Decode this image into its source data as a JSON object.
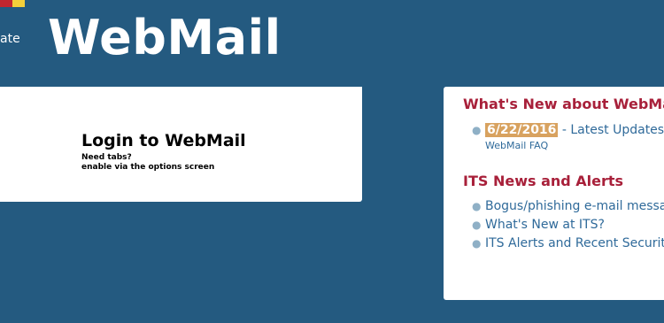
{
  "header": {
    "brand_fragment": "ate",
    "title": "WebMail"
  },
  "login": {
    "heading": "Login to WebMail",
    "hint_line1": "Need tabs?",
    "hint_line2": "enable via the options screen"
  },
  "whats_new": {
    "heading": "What's New about WebMa",
    "items": [
      {
        "date": "6/22/2016",
        "text": " - Latest Updates",
        "sublink": "WebMail FAQ"
      }
    ]
  },
  "its_news": {
    "heading": "ITS News and Alerts",
    "items": [
      {
        "text": "Bogus/phishing e-mail messag"
      },
      {
        "text": "What's New at ITS?"
      },
      {
        "text": "ITS Alerts and Recent Security"
      }
    ]
  },
  "colors": {
    "background": "#245a80",
    "heading_accent": "#a8203a",
    "link": "#2f6a9a",
    "date_highlight": "#d8a25f"
  }
}
